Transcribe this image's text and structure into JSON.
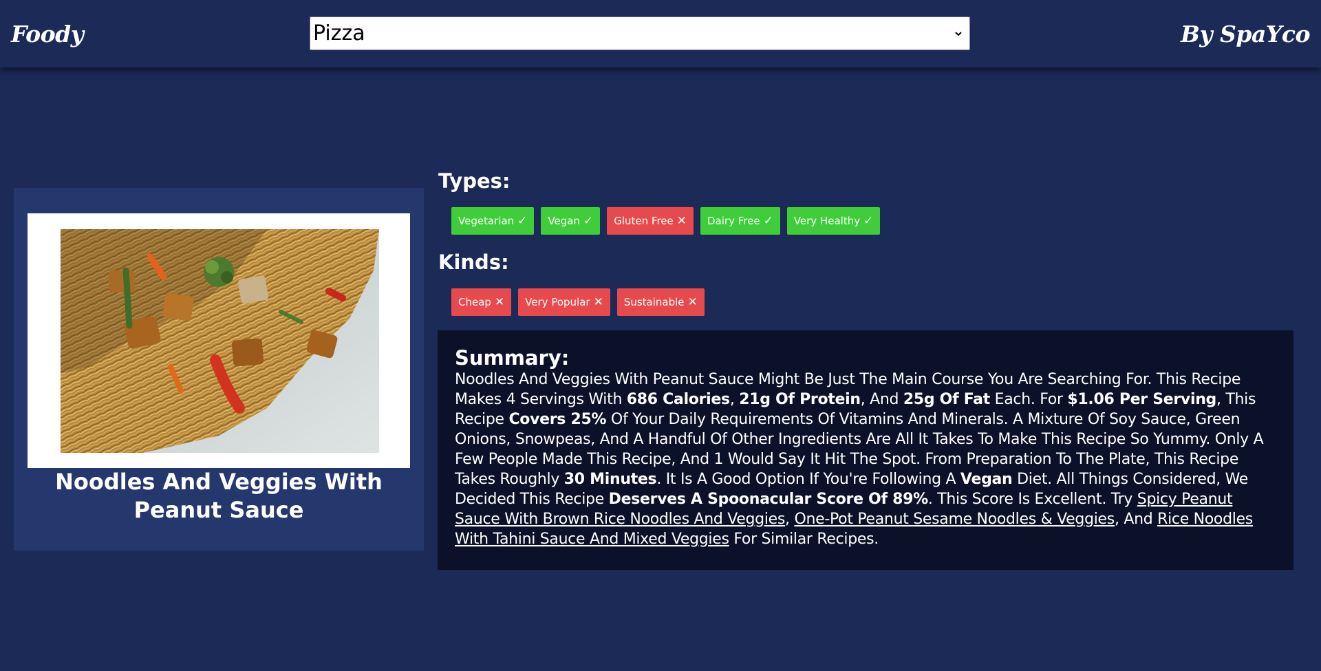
{
  "header": {
    "brand": "Foody",
    "byline": "By SpaYco",
    "search_select": {
      "value": "Pizza"
    }
  },
  "recipe": {
    "title": "Noodles And Veggies With Peanut Sauce",
    "image_alt": "Noodles and veggies stir fry photo"
  },
  "types": {
    "heading": "Types:",
    "tags": [
      {
        "label": "Vegetarian",
        "mark": "✓",
        "status": "yes"
      },
      {
        "label": "Vegan",
        "mark": "✓",
        "status": "yes"
      },
      {
        "label": "Gluten Free",
        "mark": "✕",
        "status": "no"
      },
      {
        "label": "Dairy Free",
        "mark": "✓",
        "status": "yes"
      },
      {
        "label": "Very Healthy",
        "mark": "✓",
        "status": "yes"
      }
    ]
  },
  "kinds": {
    "heading": "Kinds:",
    "tags": [
      {
        "label": "Cheap",
        "mark": "✕",
        "status": "no"
      },
      {
        "label": "Very Popular",
        "mark": "✕",
        "status": "no"
      },
      {
        "label": "Sustainable",
        "mark": "✕",
        "status": "no"
      }
    ]
  },
  "summary": {
    "heading": "Summary:",
    "segments": [
      {
        "t": "text",
        "v": "Noodles And Veggies With Peanut Sauce Might Be Just The Main Course You Are Searching For. This Recipe Makes 4 Servings With "
      },
      {
        "t": "bold",
        "v": "686 Calories"
      },
      {
        "t": "text",
        "v": ", "
      },
      {
        "t": "bold",
        "v": "21g Of Protein"
      },
      {
        "t": "text",
        "v": ", And "
      },
      {
        "t": "bold",
        "v": "25g Of Fat"
      },
      {
        "t": "text",
        "v": " Each. For "
      },
      {
        "t": "bold",
        "v": "$1.06 Per Serving"
      },
      {
        "t": "text",
        "v": ", This Recipe "
      },
      {
        "t": "bold",
        "v": "Covers 25%"
      },
      {
        "t": "text",
        "v": " Of Your Daily Requirements Of Vitamins And Minerals. A Mixture Of Soy Sauce, Green Onions, Snowpeas, And A Handful Of Other Ingredients Are All It Takes To Make This Recipe So Yummy. Only A Few People Made This Recipe, And 1 Would Say It Hit The Spot. From Preparation To The Plate, This Recipe Takes Roughly "
      },
      {
        "t": "bold",
        "v": "30 Minutes"
      },
      {
        "t": "text",
        "v": ". It Is A Good Option If You're Following A "
      },
      {
        "t": "bold",
        "v": "Vegan"
      },
      {
        "t": "text",
        "v": " Diet. All Things Considered, We Decided This Recipe "
      },
      {
        "t": "bold",
        "v": "Deserves A Spoonacular Score Of 89%"
      },
      {
        "t": "text",
        "v": ". This Score Is Excellent. Try "
      },
      {
        "t": "link",
        "v": "Spicy Peanut Sauce With Brown Rice Noodles And Veggies"
      },
      {
        "t": "text",
        "v": ", "
      },
      {
        "t": "link",
        "v": "One-Pot Peanut Sesame Noodles & Veggies"
      },
      {
        "t": "text",
        "v": ", And "
      },
      {
        "t": "link",
        "v": "Rice Noodles With Tahini Sauce And Mixed Veggies"
      },
      {
        "t": "text",
        "v": " For Similar Recipes."
      }
    ]
  },
  "colors": {
    "background": "#1b2a57",
    "card": "#25386e",
    "summary_bg": "#0b1128",
    "tag_yes": "#3fce3a",
    "tag_no": "#e74a4d"
  }
}
